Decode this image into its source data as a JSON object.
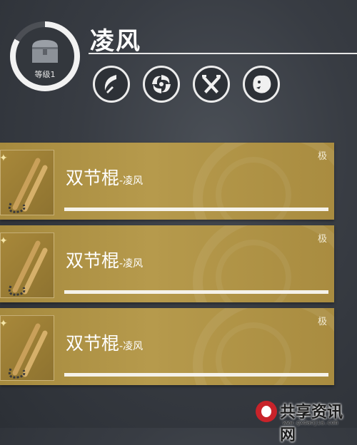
{
  "character": {
    "name": "凌风",
    "level_label": "等级1",
    "avatar_icon": "chest-icon"
  },
  "skills": [
    {
      "icon": "crescent-slash-icon"
    },
    {
      "icon": "whirlwind-icon"
    },
    {
      "icon": "crossed-blades-icon"
    },
    {
      "icon": "beast-head-icon"
    }
  ],
  "items": [
    {
      "name": "双节棍",
      "suffix": "-凌风",
      "tier": "极",
      "icon": "nunchaku-icon",
      "progress": 1.0
    },
    {
      "name": "双节棍",
      "suffix": "-凌风",
      "tier": "极",
      "icon": "nunchaku-icon",
      "progress": 1.0
    },
    {
      "name": "双节棍",
      "suffix": "-凌风",
      "tier": "极",
      "icon": "nunchaku-icon",
      "progress": 1.0
    }
  ],
  "watermark": {
    "brand": "共享资讯网",
    "url": "www.gxdaojia.com"
  },
  "colors": {
    "card_gold": "#b69a4c",
    "background": "#383c43",
    "accent_white": "#f5f2ea"
  }
}
